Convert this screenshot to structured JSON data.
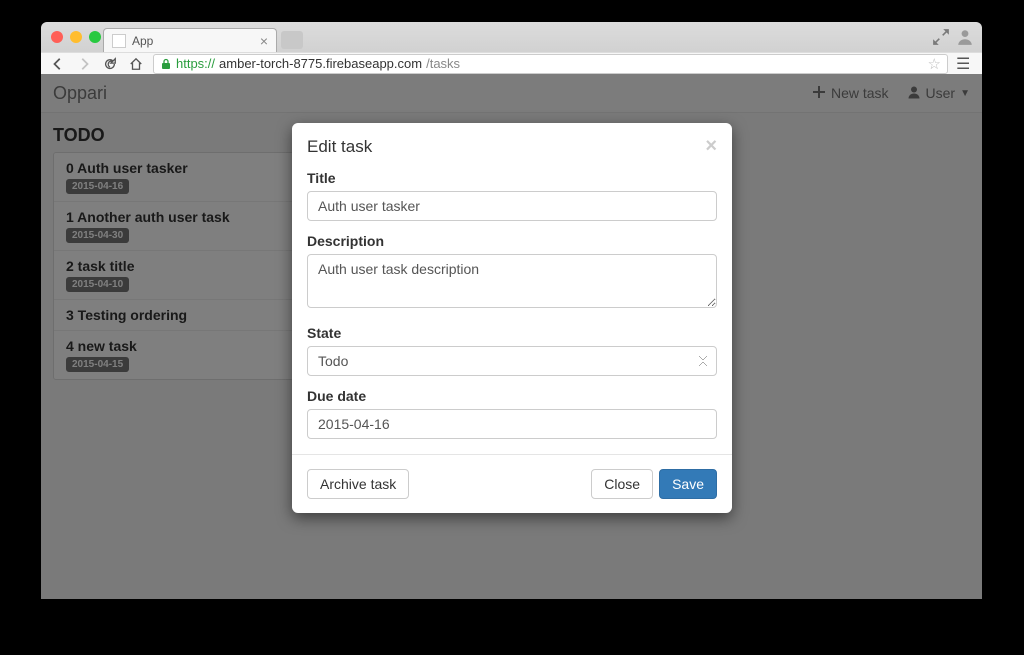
{
  "browser": {
    "tab_title": "App",
    "url_https": "https://",
    "url_domain": "amber-torch-8775.firebaseapp.com",
    "url_path": "/tasks"
  },
  "header": {
    "brand": "Oppari",
    "new_task": "New task",
    "user": "User"
  },
  "column": {
    "title": "TODO"
  },
  "tasks": [
    {
      "title": "0 Auth user tasker",
      "due": "2015-04-16"
    },
    {
      "title": "1 Another auth user task",
      "due": "2015-04-30"
    },
    {
      "title": "2 task title",
      "due": "2015-04-10"
    },
    {
      "title": "3 Testing ordering",
      "due": ""
    },
    {
      "title": "4 new task",
      "due": "2015-04-15"
    }
  ],
  "modal": {
    "title": "Edit task",
    "labels": {
      "title": "Title",
      "description": "Description",
      "state": "State",
      "due_date": "Due date"
    },
    "values": {
      "title": "Auth user tasker",
      "description": "Auth user task description",
      "state": "Todo",
      "due_date": "2015-04-16"
    },
    "buttons": {
      "archive": "Archive task",
      "close": "Close",
      "save": "Save"
    }
  }
}
